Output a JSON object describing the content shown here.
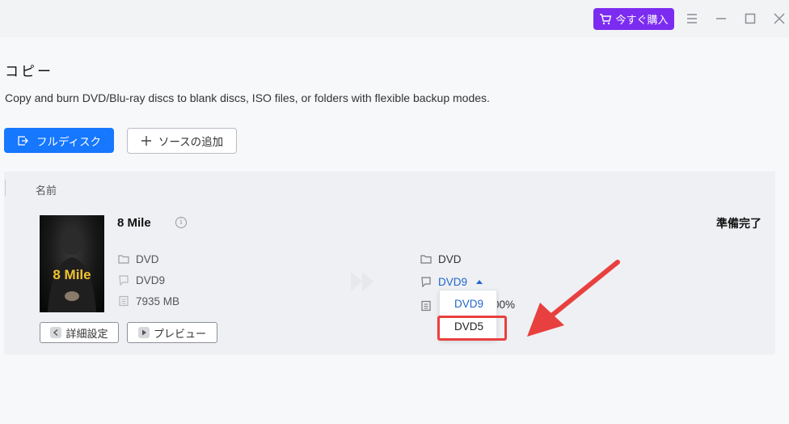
{
  "titlebar": {
    "buy_label": "今すぐ購入",
    "buy_icon": "cart-icon",
    "controls": [
      "menu-icon",
      "minimize-icon",
      "maximize-icon",
      "close-icon"
    ],
    "accent_color": "#7b2cf0"
  },
  "page": {
    "title": "コピー",
    "description": "Copy and burn DVD/Blu-ray discs to blank discs, ISO files, or folders with flexible backup modes."
  },
  "toolbar": {
    "full_disk_label": "フルディスク",
    "full_disk_icon": "copy-mode-icon",
    "add_source_label": "ソースの追加",
    "add_source_icon": "plus-icon",
    "primary_color": "#1677ff"
  },
  "list": {
    "column_name": "名前",
    "item": {
      "title": "8 Mile",
      "cover_text": "8 Mile",
      "source": {
        "type": "DVD",
        "disc": "DVD9",
        "size": "7935 MB"
      },
      "output": {
        "type": "DVD",
        "disc": "DVD9",
        "ratio_suffix": "00%"
      },
      "status": "準備完了",
      "advanced_label": "詳細設定",
      "preview_label": "プレビュー"
    }
  },
  "dropdown": {
    "options": [
      "DVD9",
      "DVD5"
    ],
    "selected": "DVD9",
    "highlighted": "DVD5",
    "selected_color": "#2266cc",
    "highlight_color": "#e8403f"
  }
}
